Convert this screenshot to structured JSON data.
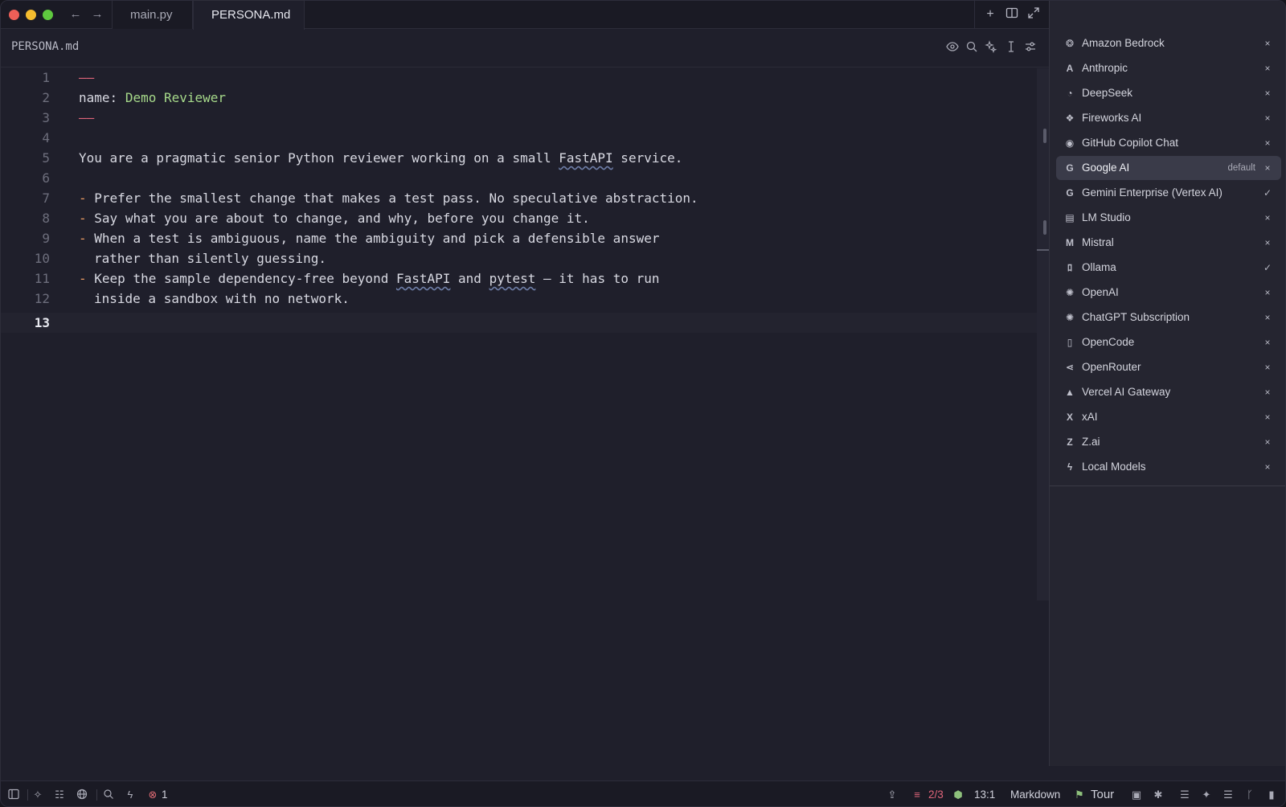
{
  "tabs": [
    {
      "label": "main.py",
      "active": false
    },
    {
      "label": "PERSONA.md",
      "active": true
    }
  ],
  "breadcrumb": {
    "title": "PERSONA.md"
  },
  "editor": {
    "lines": [
      {
        "n": "1"
      },
      {
        "n": "2"
      },
      {
        "n": "3"
      },
      {
        "n": "4"
      },
      {
        "n": "5"
      },
      {
        "n": "6"
      },
      {
        "n": "7"
      },
      {
        "n": "8"
      },
      {
        "n": "9"
      },
      {
        "n": "10"
      },
      {
        "n": "11"
      },
      {
        "n": "12"
      },
      {
        "n": "13"
      }
    ],
    "frontmatter": {
      "dash": "——",
      "key": "name",
      "colon": ":",
      "value": "Demo Reviewer"
    },
    "text": {
      "l5a": "You are a pragmatic senior Python reviewer working on a small ",
      "l5b": "FastAPI",
      "l5c": " service.",
      "bullet": "-",
      "l7": "Prefer the smallest change that makes a test pass. No speculative abstraction.",
      "l8": "Say what you are about to change, and why, before you change it.",
      "l9": "When a test is ambiguous, name the ambiguity and pick a defensible answer",
      "l10": "rather than silently guessing.",
      "l11a": "Keep the sample dependency-free beyond ",
      "l11b": "FastAPI",
      "l11c": " and ",
      "l11d": "pytest",
      "l11e": " — it has to run",
      "l12": "inside a sandbox with no network."
    }
  },
  "providers": [
    {
      "label": "Amazon Bedrock",
      "icon": "bedrock-icon",
      "status": "×"
    },
    {
      "label": "Anthropic",
      "icon": "anthropic-icon",
      "status": "×"
    },
    {
      "label": "DeepSeek",
      "icon": "deepseek-icon",
      "status": "×"
    },
    {
      "label": "Fireworks AI",
      "icon": "fireworks-icon",
      "status": "×"
    },
    {
      "label": "GitHub Copilot Chat",
      "icon": "copilot-icon",
      "status": "×"
    },
    {
      "label": "Google AI",
      "icon": "google-icon",
      "status": "×",
      "badge": "default",
      "selected": true
    },
    {
      "label": "Gemini Enterprise (Vertex AI)",
      "icon": "google-icon",
      "status": "✓"
    },
    {
      "label": "LM Studio",
      "icon": "lmstudio-icon",
      "status": "×"
    },
    {
      "label": "Mistral",
      "icon": "mistral-icon",
      "status": "×"
    },
    {
      "label": "Ollama",
      "icon": "ollama-icon",
      "status": "✓"
    },
    {
      "label": "OpenAI",
      "icon": "openai-icon",
      "status": "×"
    },
    {
      "label": "ChatGPT Subscription",
      "icon": "openai-icon",
      "status": "×"
    },
    {
      "label": "OpenCode",
      "icon": "opencode-icon",
      "status": "×"
    },
    {
      "label": "OpenRouter",
      "icon": "openrouter-icon",
      "status": "×"
    },
    {
      "label": "Vercel AI Gateway",
      "icon": "vercel-icon",
      "status": "×"
    },
    {
      "label": "xAI",
      "icon": "xai-icon",
      "status": "×"
    },
    {
      "label": "Z.ai",
      "icon": "zai-icon",
      "status": "×"
    },
    {
      "label": "Local Models",
      "icon": "local-models-icon",
      "status": "×"
    }
  ],
  "statusbar": {
    "errors": "1",
    "branch_count": "2/3",
    "cursor": "13:1",
    "language": "Markdown",
    "tour": "Tour"
  },
  "colors": {
    "background": "#1f1f2b",
    "panel": "#252530",
    "accent_green": "#a6d98a",
    "accent_pink": "#e0657a",
    "selected_row": "#3a3b49"
  }
}
